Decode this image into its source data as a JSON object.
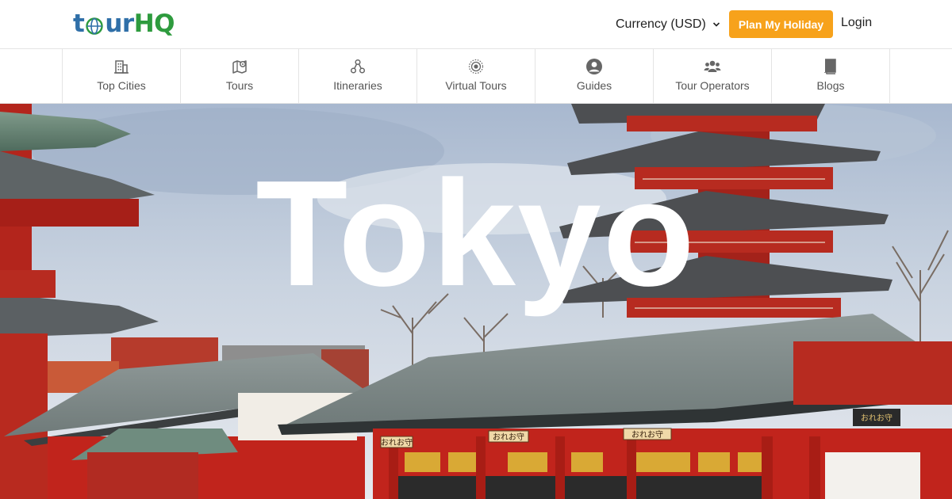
{
  "header": {
    "logo": {
      "part1": "t",
      "part2": "ur",
      "part3": "HQ"
    },
    "currency_label": "Currency (USD)",
    "plan_button": "Plan My Holiday",
    "login": "Login"
  },
  "nav": {
    "items": [
      {
        "label": "Top Cities",
        "icon": "building-icon"
      },
      {
        "label": "Tours",
        "icon": "map-pin-icon"
      },
      {
        "label": "Itineraries",
        "icon": "itinerary-icon"
      },
      {
        "label": "Virtual Tours",
        "icon": "virtual-tour-icon"
      },
      {
        "label": "Guides",
        "icon": "user-circle-icon"
      },
      {
        "label": "Tour Operators",
        "icon": "users-icon"
      },
      {
        "label": "Blogs",
        "icon": "book-icon"
      }
    ]
  },
  "hero": {
    "title": "Tokyo",
    "signs": [
      "おれお守",
      "おれお守",
      "おれお守",
      "おれお守"
    ]
  },
  "colors": {
    "accent": "#f7a21b",
    "logo_blue": "#2f6fa8",
    "logo_green": "#2e9b3e",
    "temple_red": "#c1241c"
  }
}
